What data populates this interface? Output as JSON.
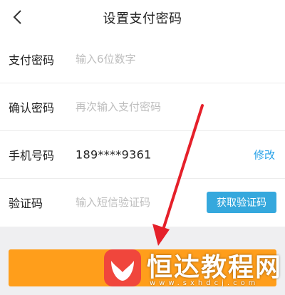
{
  "header": {
    "title": "设置支付密码",
    "back_icon": "chevron-left-icon"
  },
  "form": {
    "pay_password": {
      "label": "支付密码",
      "placeholder": "输入6位数字",
      "value": ""
    },
    "confirm_password": {
      "label": "确认密码",
      "placeholder": "再次输入支付密码",
      "value": ""
    },
    "phone": {
      "label": "手机号码",
      "value": "189****9361",
      "modify_label": "修改"
    },
    "verify_code": {
      "label": "验证码",
      "placeholder": "输入短信验证码",
      "value": "",
      "get_code_label": "获取验证码"
    }
  },
  "submit": {
    "label": ""
  },
  "watermark": {
    "text": "恒达教程网",
    "url": "www.sxhdcj.com"
  },
  "colors": {
    "accent_blue": "#35a8dd",
    "link_blue": "#2aa3e8",
    "submit_orange": "#ff9e1b",
    "arrow_red": "#e5202a",
    "logo_red": "#f0463c"
  }
}
